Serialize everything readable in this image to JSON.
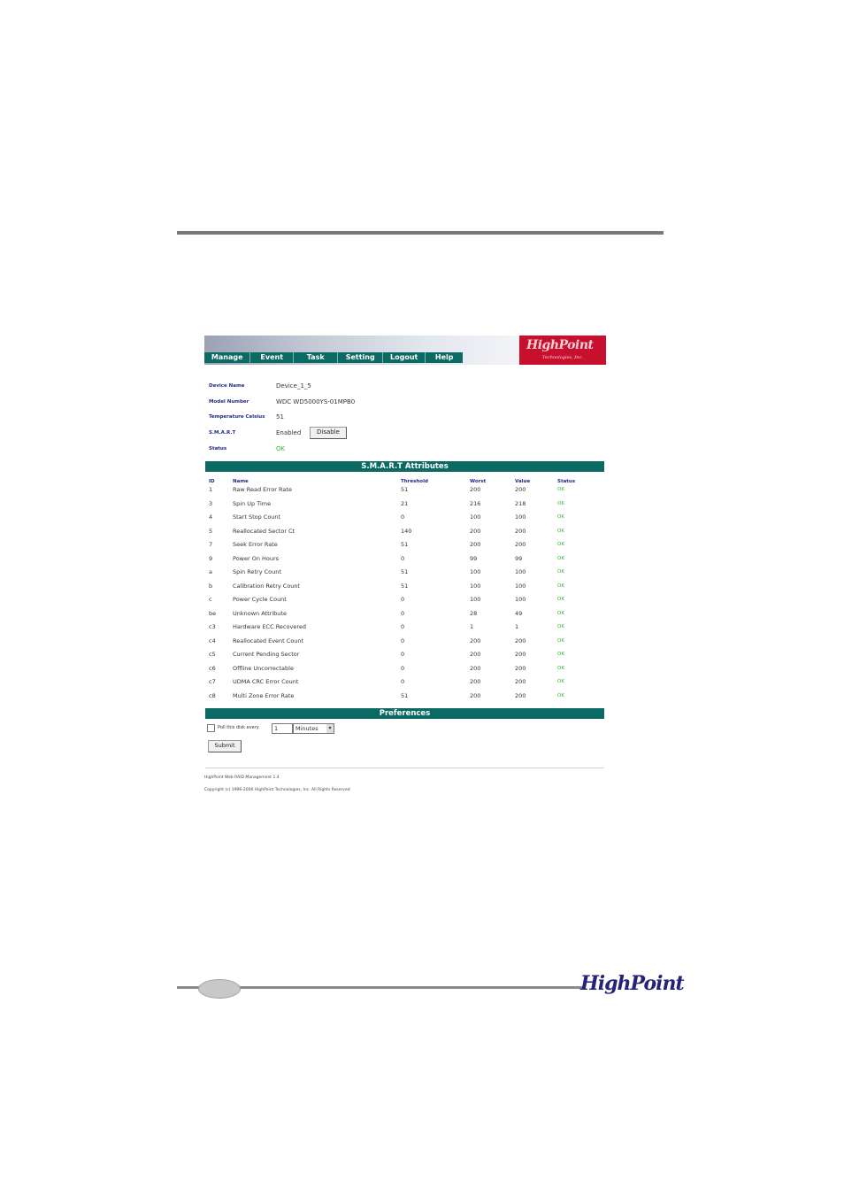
{
  "nav": [
    "Manage",
    "Event",
    "Task",
    "Setting",
    "Logout",
    "Help"
  ],
  "brand": {
    "name": "HighPoint",
    "sub": "Technologies, Inc."
  },
  "device": {
    "name_label": "Device Name",
    "name_value": "Device_1_5",
    "model_label": "Model Number",
    "model_value": "WDC WD5000YS-01MPB0",
    "temp_label": "Temperature Celsius",
    "temp_value": "51",
    "smart_label": "S.M.A.R.T",
    "smart_value": "Enabled",
    "smart_button": "Disable",
    "status_label": "Status",
    "status_value": "OK"
  },
  "smart_title": "S.M.A.R.T Attributes",
  "smart_headers": {
    "id": "ID",
    "name": "Name",
    "threshold": "Threshold",
    "worst": "Worst",
    "value": "Value",
    "status": "Status"
  },
  "smart_rows": [
    {
      "id": "1",
      "name": "Raw Read Error Rate",
      "threshold": "51",
      "worst": "200",
      "value": "200",
      "status": "OK"
    },
    {
      "id": "3",
      "name": "Spin Up Time",
      "threshold": "21",
      "worst": "216",
      "value": "218",
      "status": "OK"
    },
    {
      "id": "4",
      "name": "Start Stop Count",
      "threshold": "0",
      "worst": "100",
      "value": "100",
      "status": "OK"
    },
    {
      "id": "5",
      "name": "Reallocated Sector Ct",
      "threshold": "140",
      "worst": "200",
      "value": "200",
      "status": "OK"
    },
    {
      "id": "7",
      "name": "Seek Error Rate",
      "threshold": "51",
      "worst": "200",
      "value": "200",
      "status": "OK"
    },
    {
      "id": "9",
      "name": "Power On Hours",
      "threshold": "0",
      "worst": "99",
      "value": "99",
      "status": "OK"
    },
    {
      "id": "a",
      "name": "Spin Retry Count",
      "threshold": "51",
      "worst": "100",
      "value": "100",
      "status": "OK"
    },
    {
      "id": "b",
      "name": "Calibration Retry Count",
      "threshold": "51",
      "worst": "100",
      "value": "100",
      "status": "OK"
    },
    {
      "id": "c",
      "name": "Power Cycle Count",
      "threshold": "0",
      "worst": "100",
      "value": "100",
      "status": "OK"
    },
    {
      "id": "be",
      "name": "Unknown Attribute",
      "threshold": "0",
      "worst": "28",
      "value": "49",
      "status": "OK"
    },
    {
      "id": "c3",
      "name": "Hardware ECC Recovered",
      "threshold": "0",
      "worst": "1",
      "value": "1",
      "status": "OK"
    },
    {
      "id": "c4",
      "name": "Reallocated Event Count",
      "threshold": "0",
      "worst": "200",
      "value": "200",
      "status": "OK"
    },
    {
      "id": "c5",
      "name": "Current Pending Sector",
      "threshold": "0",
      "worst": "200",
      "value": "200",
      "status": "OK"
    },
    {
      "id": "c6",
      "name": "Offline Uncorrectable",
      "threshold": "0",
      "worst": "200",
      "value": "200",
      "status": "OK"
    },
    {
      "id": "c7",
      "name": "UDMA CRC Error Count",
      "threshold": "0",
      "worst": "200",
      "value": "200",
      "status": "OK"
    },
    {
      "id": "c8",
      "name": "Multi Zone Error Rate",
      "threshold": "51",
      "worst": "200",
      "value": "200",
      "status": "OK"
    }
  ],
  "prefs": {
    "title": "Preferences",
    "poll_label": "Poll this disk every",
    "poll_value": "1",
    "unit": "Minutes",
    "submit": "Submit"
  },
  "footer": {
    "product": "HighPoint Web RAID Management 1.4",
    "copyright": "Copyright (c) 1996-2006 HighPoint Technologies, Inc. All Rights Reserved"
  },
  "page_logo": "HighPoint"
}
